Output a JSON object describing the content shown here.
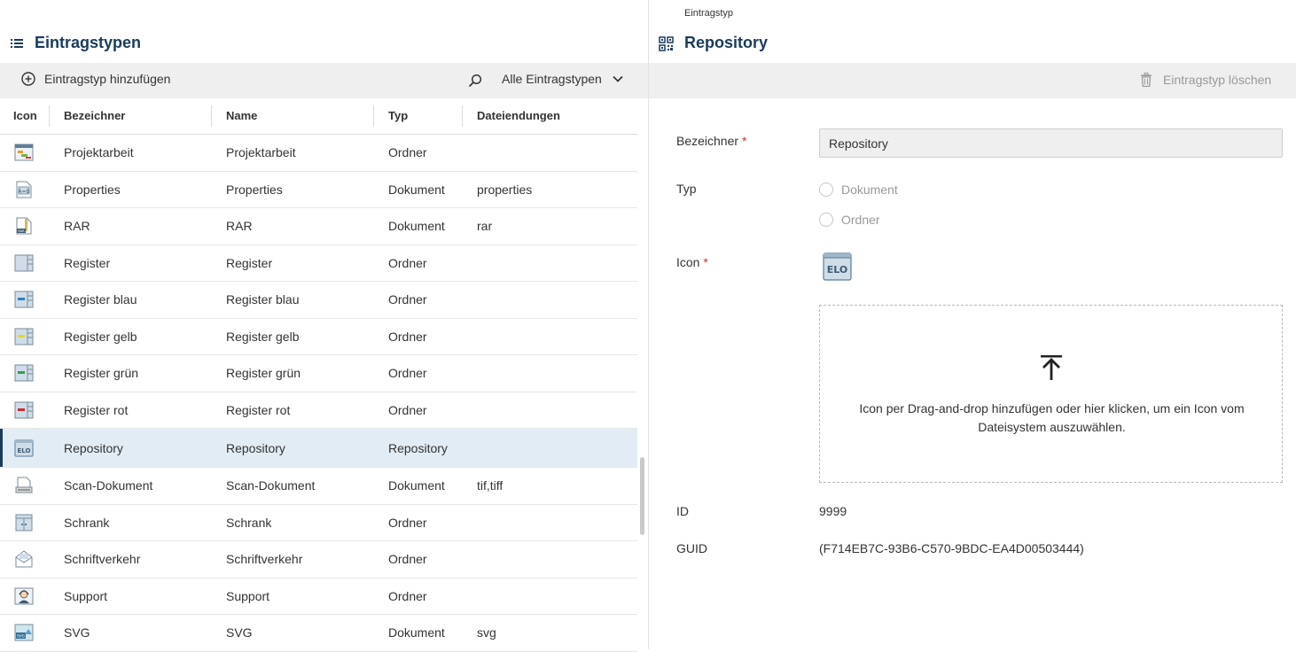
{
  "left": {
    "title": "Eintragstypen",
    "add_label": "Eintragstyp hinzufügen",
    "filter_label": "Alle Eintragstypen",
    "columns": [
      "Icon",
      "Bezeichner",
      "Name",
      "Typ",
      "Dateiendungen"
    ],
    "rows": [
      {
        "bezeichner": "Projektarbeit",
        "name": "Projektarbeit",
        "typ": "Ordner",
        "ext": "",
        "icon": "projektarbeit-icon"
      },
      {
        "bezeichner": "Properties",
        "name": "Properties",
        "typ": "Dokument",
        "ext": "properties",
        "icon": "properties-icon"
      },
      {
        "bezeichner": "RAR",
        "name": "RAR",
        "typ": "Dokument",
        "ext": "rar",
        "icon": "rar-icon"
      },
      {
        "bezeichner": "Register",
        "name": "Register",
        "typ": "Ordner",
        "ext": "",
        "icon": "register-icon"
      },
      {
        "bezeichner": "Register blau",
        "name": "Register blau",
        "typ": "Ordner",
        "ext": "",
        "icon": "register-blau-icon"
      },
      {
        "bezeichner": "Register gelb",
        "name": "Register gelb",
        "typ": "Ordner",
        "ext": "",
        "icon": "register-gelb-icon"
      },
      {
        "bezeichner": "Register grün",
        "name": "Register grün",
        "typ": "Ordner",
        "ext": "",
        "icon": "register-gruen-icon"
      },
      {
        "bezeichner": "Register rot",
        "name": "Register rot",
        "typ": "Ordner",
        "ext": "",
        "icon": "register-rot-icon"
      },
      {
        "bezeichner": "Repository",
        "name": "Repository",
        "typ": "Repository",
        "ext": "",
        "icon": "elo-repository-icon",
        "selected": true
      },
      {
        "bezeichner": "Scan-Dokument",
        "name": "Scan-Dokument",
        "typ": "Dokument",
        "ext": "tif,tiff",
        "icon": "scan-icon"
      },
      {
        "bezeichner": "Schrank",
        "name": "Schrank",
        "typ": "Ordner",
        "ext": "",
        "icon": "schrank-icon"
      },
      {
        "bezeichner": "Schriftverkehr",
        "name": "Schriftverkehr",
        "typ": "Ordner",
        "ext": "",
        "icon": "schriftverkehr-icon"
      },
      {
        "bezeichner": "Support",
        "name": "Support",
        "typ": "Ordner",
        "ext": "",
        "icon": "support-icon"
      },
      {
        "bezeichner": "SVG",
        "name": "SVG",
        "typ": "Dokument",
        "ext": "svg",
        "icon": "svg-icon"
      }
    ]
  },
  "right": {
    "breadcrumb": "Eintragstyp",
    "title": "Repository",
    "delete_label": "Eintragstyp löschen",
    "labels": {
      "bezeichner": "Bezeichner",
      "typ": "Typ",
      "icon": "Icon",
      "id": "ID",
      "guid": "GUID",
      "required_mark": "*"
    },
    "bezeichner_value": "Repository",
    "typ_options": [
      "Dokument",
      "Ordner"
    ],
    "preview_icon_text": "ELO",
    "drop_message": "Icon per Drag-and-drop hinzufügen oder hier klicken, um ein Icon vom Dateisystem auszuwählen.",
    "id_value": "9999",
    "guid_value": "(F714EB7C-93B6-C570-9BDC-EA4D00503444)"
  },
  "colors": {
    "accent": "#1a3b5c",
    "selected_row": "#e2ecf4",
    "toolbar": "#efefef",
    "required": "#c9342f"
  }
}
